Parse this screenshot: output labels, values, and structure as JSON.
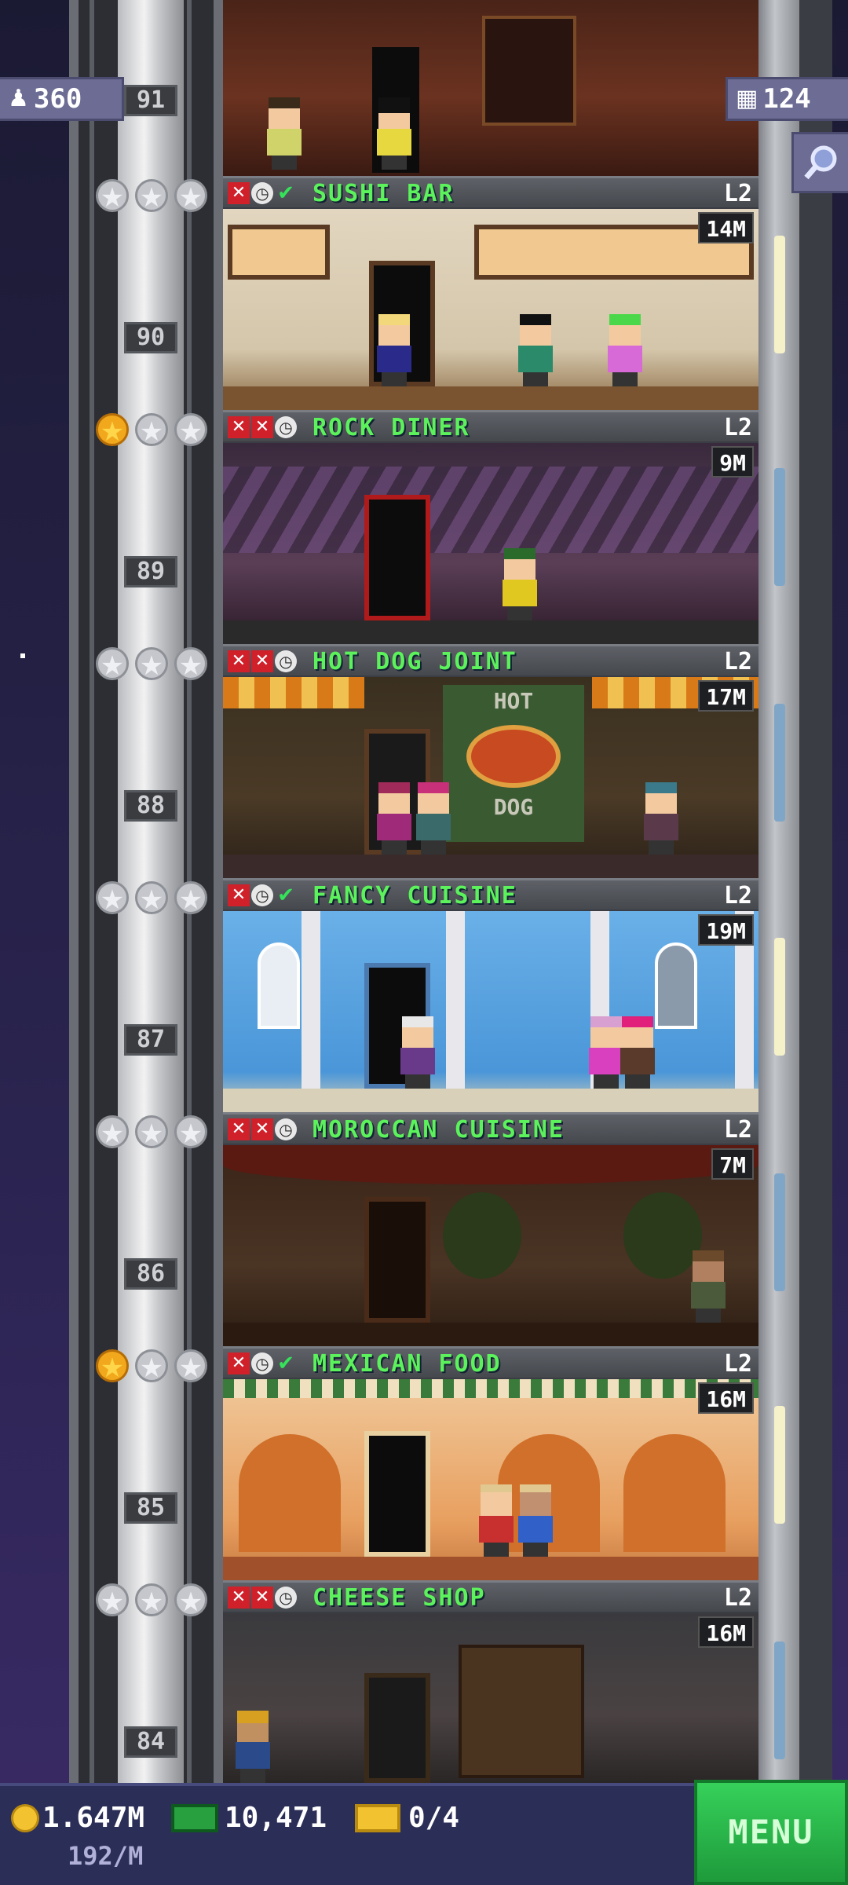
{
  "hud": {
    "population": "360",
    "floors_count": "124"
  },
  "top_floor": {
    "number": "91"
  },
  "floors": [
    {
      "number": "90",
      "name": "SUSHI BAR",
      "level": "L2",
      "timer": "14M",
      "stars_gold": 0,
      "status": [
        "x",
        "clock",
        "check"
      ]
    },
    {
      "number": "89",
      "name": "ROCK DINER",
      "level": "L2",
      "timer": "9M",
      "stars_gold": 1,
      "status": [
        "x",
        "x",
        "clock"
      ]
    },
    {
      "number": "88",
      "name": "HOT DOG JOINT",
      "level": "L2",
      "timer": "17M",
      "stars_gold": 0,
      "status": [
        "x",
        "x",
        "clock"
      ]
    },
    {
      "number": "87",
      "name": "FANCY CUISINE",
      "level": "L2",
      "timer": "19M",
      "stars_gold": 0,
      "status": [
        "x",
        "clock",
        "check"
      ]
    },
    {
      "number": "86",
      "name": "MOROCCAN CUISINE",
      "level": "L2",
      "timer": "7M",
      "stars_gold": 0,
      "status": [
        "x",
        "x",
        "clock"
      ]
    },
    {
      "number": "85",
      "name": "MEXICAN FOOD",
      "level": "L2",
      "timer": "16M",
      "stars_gold": 1,
      "status": [
        "x",
        "clock",
        "check"
      ]
    },
    {
      "number": "84",
      "name": "CHEESE SHOP",
      "level": "L2",
      "timer": "16M",
      "stars_gold": 0,
      "status": [
        "x",
        "x",
        "clock"
      ]
    }
  ],
  "room_signs": {
    "hot_dog_top": "HOT",
    "hot_dog_bottom": "DOG"
  },
  "bottom": {
    "coins": "1.647M",
    "coins_rate": "192/M",
    "bux": "10,471",
    "tickets": "0/4",
    "menu_label": "MENU"
  },
  "colors": {
    "floor_name": "#5cf25c",
    "menu": "#1e9a3b",
    "hud_pill": "#6c6c94"
  },
  "icons": [
    "person-icon",
    "building-icon",
    "search-icon",
    "coin-icon",
    "bux-icon",
    "ticket-icon",
    "star-icon",
    "x-icon",
    "clock-icon",
    "check-icon"
  ]
}
